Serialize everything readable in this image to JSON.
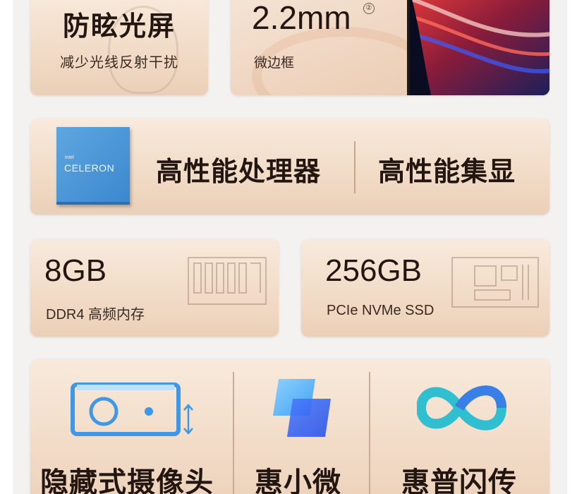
{
  "antiglare": {
    "title": "防眩光屏",
    "subtitle": "减少光线反射干扰"
  },
  "bezel": {
    "value": "2.2mm",
    "footnote": "②",
    "subtitle": "微边框"
  },
  "processor": {
    "chip_brand": "intel",
    "chip_model": "CELERON",
    "cpu_label": "高性能处理器",
    "gpu_label": "高性能集显"
  },
  "memory": {
    "value": "8GB",
    "subtitle": "DDR4 高频内存"
  },
  "storage": {
    "value": "256GB",
    "subtitle": "PCIe NVMe SSD"
  },
  "features": {
    "camera_label": "隐藏式摄像头",
    "weixiao_label": "惠小微",
    "flash_label": "惠普闪传"
  },
  "colors": {
    "card_bg": "#f2dcc8",
    "text": "#231510",
    "chip_blue": "#3b86cf",
    "camera_blue": "#3f97e8",
    "flash_teal": "#2fbfd0"
  },
  "icons": [
    "lightbulb-icon",
    "cpu-chip-icon",
    "ram-module-icon",
    "ssd-module-icon",
    "camera-icon",
    "up-down-arrow-icon",
    "weixiao-app-icon",
    "flash-transfer-icon"
  ]
}
